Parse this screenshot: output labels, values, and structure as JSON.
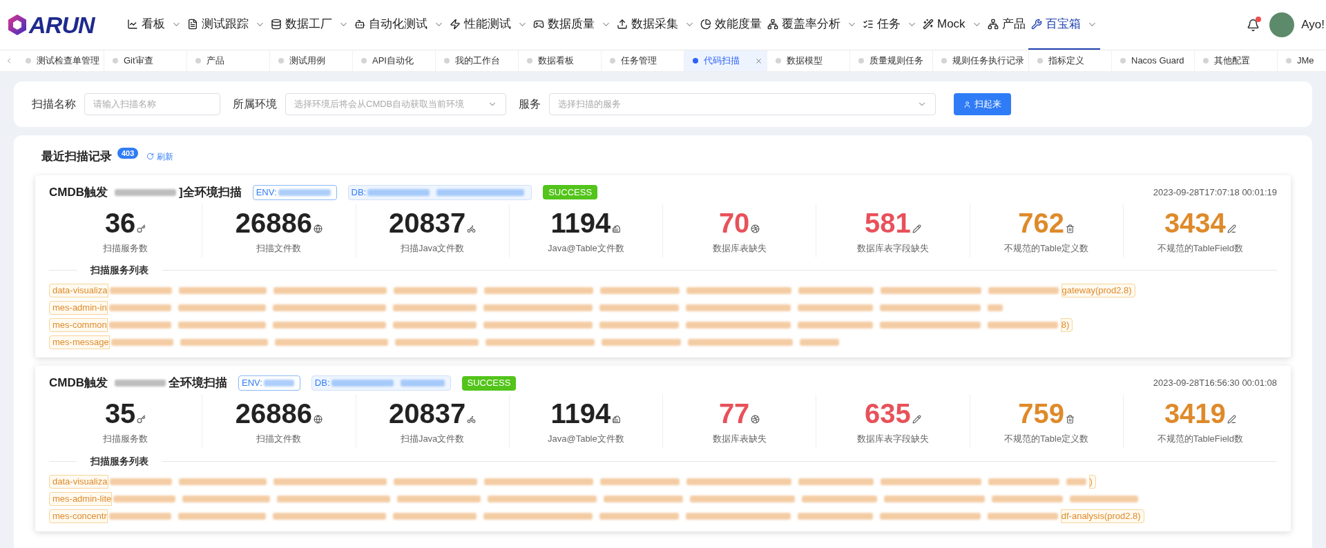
{
  "nav": {
    "logo": "ARUN",
    "items": [
      {
        "label": "看板",
        "dropdown": true,
        "selected": false
      },
      {
        "label": "测试跟踪",
        "dropdown": true,
        "selected": false
      },
      {
        "label": "数据工厂",
        "dropdown": true,
        "selected": false
      },
      {
        "label": "自动化测试",
        "dropdown": true,
        "selected": false
      },
      {
        "label": "性能测试",
        "dropdown": true,
        "selected": false
      },
      {
        "label": "数据质量",
        "dropdown": true,
        "selected": false
      },
      {
        "label": "数据采集",
        "dropdown": true,
        "selected": false
      },
      {
        "label": "效能度量",
        "dropdown": false,
        "selected": false
      },
      {
        "label": "覆盖率分析",
        "dropdown": true,
        "selected": false
      },
      {
        "label": "任务",
        "dropdown": true,
        "selected": false
      },
      {
        "label": "Mock",
        "dropdown": true,
        "selected": false
      },
      {
        "label": "产品",
        "dropdown": false,
        "selected": false
      },
      {
        "label": "百宝箱",
        "dropdown": true,
        "selected": true
      }
    ],
    "user": {
      "name": "Ayo!",
      "has_notification": true
    }
  },
  "tabs": [
    {
      "label": "测试检查单管理",
      "selected": false,
      "closable": false
    },
    {
      "label": "Git审查",
      "selected": false,
      "closable": false
    },
    {
      "label": "产品",
      "selected": false,
      "closable": false
    },
    {
      "label": "测试用例",
      "selected": false,
      "closable": false
    },
    {
      "label": "API自动化",
      "selected": false,
      "closable": false
    },
    {
      "label": "我的工作台",
      "selected": false,
      "closable": false
    },
    {
      "label": "数据看板",
      "selected": false,
      "closable": false
    },
    {
      "label": "任务管理",
      "selected": false,
      "closable": false
    },
    {
      "label": "代码扫描",
      "selected": true,
      "closable": true
    },
    {
      "label": "数据模型",
      "selected": false,
      "closable": false
    },
    {
      "label": "质量规则任务",
      "selected": false,
      "closable": false
    },
    {
      "label": "规则任务执行记录",
      "selected": false,
      "closable": false
    },
    {
      "label": "指标定义",
      "selected": false,
      "closable": false
    },
    {
      "label": "Nacos Guard",
      "selected": false,
      "closable": false
    },
    {
      "label": "其他配置",
      "selected": false,
      "closable": false
    },
    {
      "label": "JMe",
      "selected": false,
      "closable": false
    }
  ],
  "filters": {
    "fields": [
      {
        "label": "扫描名称",
        "placeholder": "请输入扫描名称",
        "kind": "input"
      },
      {
        "label": "所属环境",
        "placeholder": "选择环境后将会从CMDB自动获取当前环境",
        "kind": "select"
      },
      {
        "label": "服务",
        "placeholder": "选择扫描的服务",
        "kind": "select"
      }
    ],
    "button": "扫起来"
  },
  "records": {
    "title": "最近扫描记录",
    "count": "403",
    "refresh": "刷新",
    "items": [
      {
        "title_start": "CMDB触发",
        "title_end": "]全环境扫描",
        "env_label": "ENV:",
        "db_label": "DB:",
        "status": "SUCCESS",
        "time": "2023-09-28T17:07:18 00:01:19",
        "metrics": [
          {
            "value": "36",
            "label": "扫描服务数",
            "kind": "normal"
          },
          {
            "value": "26886",
            "label": "扫描文件数",
            "kind": "normal"
          },
          {
            "value": "20837",
            "label": "扫描Java文件数",
            "kind": "normal"
          },
          {
            "value": "1194",
            "label": "Java@Table文件数",
            "kind": "normal"
          },
          {
            "value": "70",
            "label": "数据库表缺失",
            "kind": "danger"
          },
          {
            "value": "581",
            "label": "数据库表字段缺失",
            "kind": "danger"
          },
          {
            "value": "762",
            "label": "不规范的Table定义数",
            "kind": "warning"
          },
          {
            "value": "3434",
            "label": "不规范的TableField数",
            "kind": "warning"
          }
        ],
        "services_title": "扫描服务列表",
        "service_rows": [
          {
            "lead": "data-visualiza",
            "tail": "gateway(prod2.8)"
          },
          {
            "lead": "mes-admin-in"
          },
          {
            "lead": "mes-common",
            "tail": "8)"
          },
          {
            "lead": "mes-message"
          }
        ]
      },
      {
        "title_start": "CMDB触发",
        "title_end": "全环境扫描",
        "env_label": "ENV:",
        "db_label": "DB:",
        "status": "SUCCESS",
        "time": "2023-09-28T16:56:30 00:01:08",
        "metrics": [
          {
            "value": "35",
            "label": "扫描服务数",
            "kind": "normal"
          },
          {
            "value": "26886",
            "label": "扫描文件数",
            "kind": "normal"
          },
          {
            "value": "20837",
            "label": "扫描Java文件数",
            "kind": "normal"
          },
          {
            "value": "1194",
            "label": "Java@Table文件数",
            "kind": "normal"
          },
          {
            "value": "77",
            "label": "数据库表缺失",
            "kind": "danger"
          },
          {
            "value": "635",
            "label": "数据库表字段缺失",
            "kind": "danger"
          },
          {
            "value": "759",
            "label": "不规范的Table定义数",
            "kind": "warning"
          },
          {
            "value": "3419",
            "label": "不规范的TableField数",
            "kind": "warning"
          }
        ],
        "services_title": "扫描服务列表",
        "service_rows": [
          {
            "lead": "data-visualiza",
            "tail": ")"
          },
          {
            "lead": "mes-admin-lite"
          },
          {
            "lead": "mes-concentr",
            "tail": "df-analysis(prod2.8)"
          }
        ]
      }
    ]
  }
}
